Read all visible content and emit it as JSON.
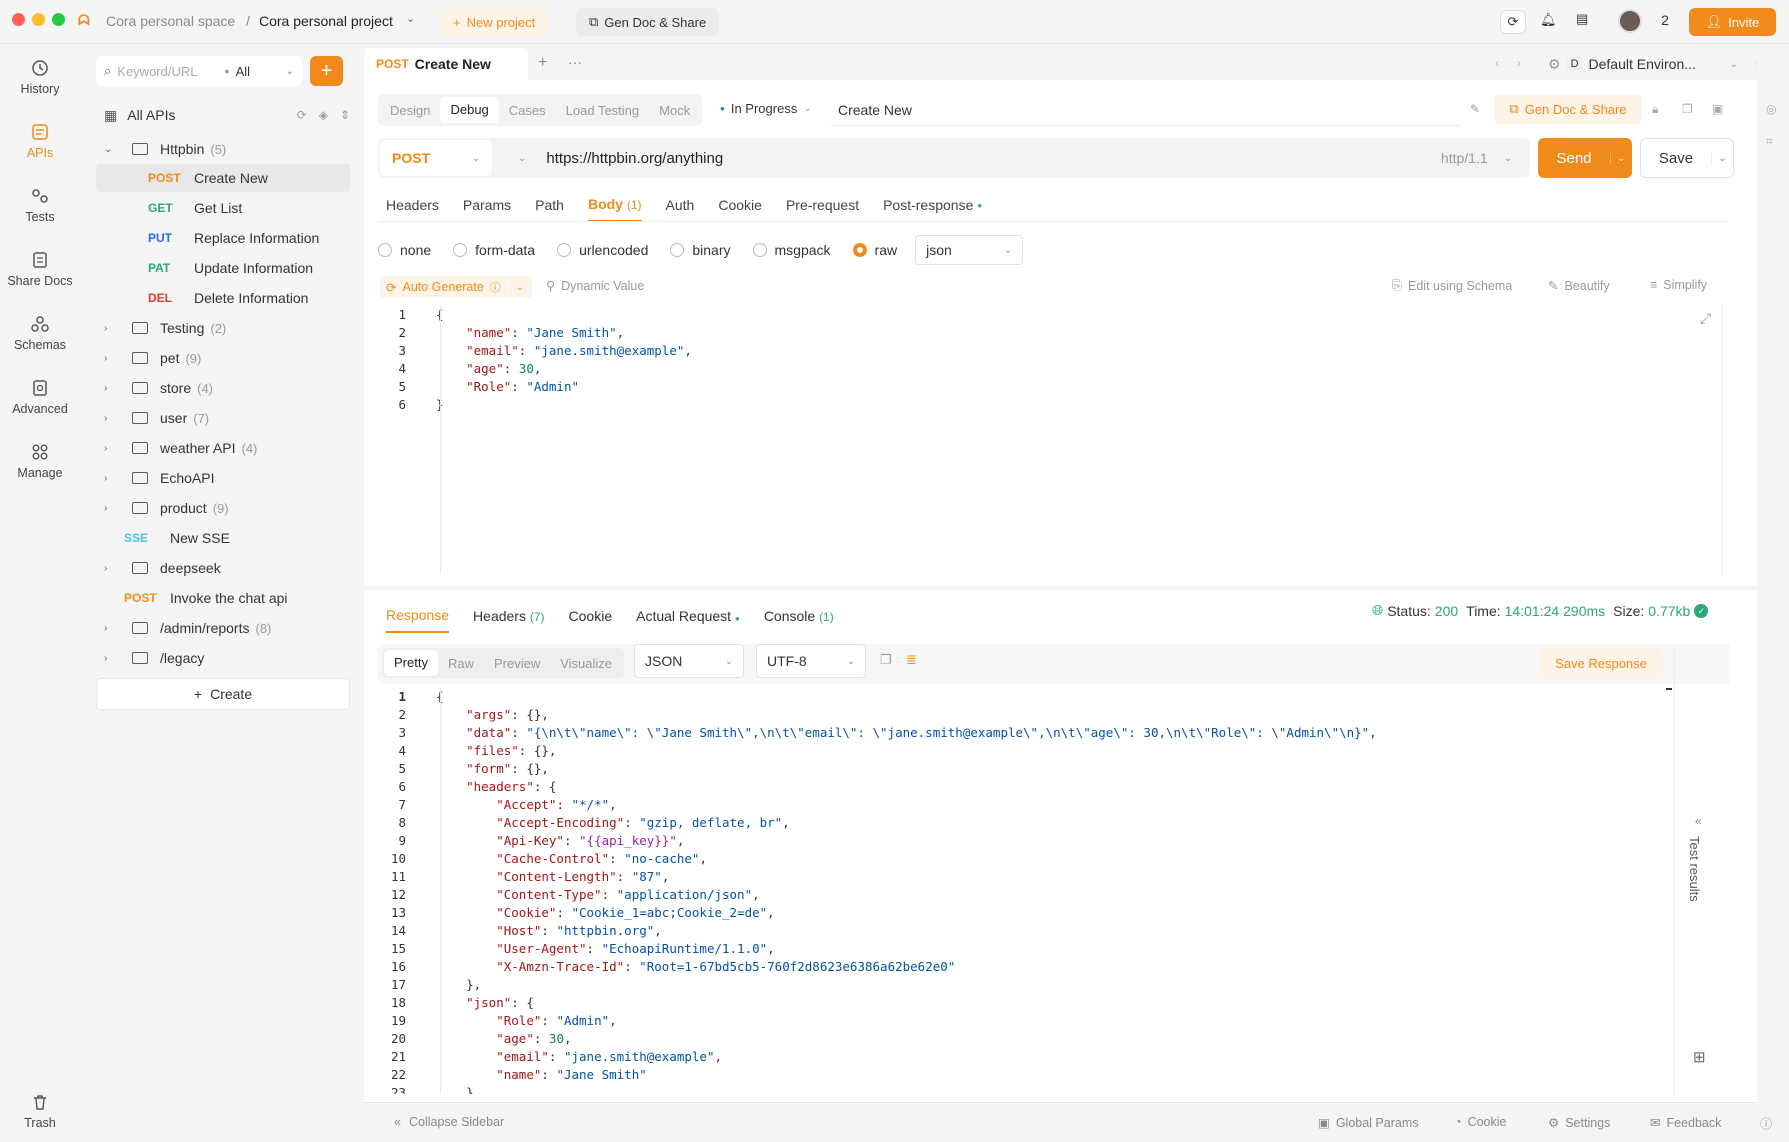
{
  "topbar": {
    "workspace": "Cora personal space",
    "separator": "/",
    "project": "Cora personal project",
    "new_project": "New project",
    "gen_doc": "Gen Doc & Share",
    "member_count": "2",
    "invite": "Invite"
  },
  "leftnav": [
    {
      "label": "History",
      "icon": "clock-icon"
    },
    {
      "label": "APIs",
      "icon": "api-icon"
    },
    {
      "label": "Tests",
      "icon": "tests-icon"
    },
    {
      "label": "Share Docs",
      "icon": "doc-icon"
    },
    {
      "label": "Schemas",
      "icon": "schema-icon"
    },
    {
      "label": "Advanced",
      "icon": "advanced-icon"
    },
    {
      "label": "Manage",
      "icon": "grid-icon"
    },
    {
      "label": "Trash",
      "icon": "trash-icon"
    }
  ],
  "sidebar": {
    "search_placeholder": "Keyword/URL",
    "filter": "All",
    "all_apis": "All APIs",
    "root": {
      "name": "Httpbin",
      "count": "(5)"
    },
    "endpoints": [
      {
        "method": "POST",
        "name": "Create New",
        "color": "#f08a1c"
      },
      {
        "method": "GET",
        "name": "Get List",
        "color": "#2aa876"
      },
      {
        "method": "PUT",
        "name": "Replace Information",
        "color": "#2a6fd6"
      },
      {
        "method": "PAT",
        "name": "Update Information",
        "color": "#2aa876"
      },
      {
        "method": "DEL",
        "name": "Delete Information",
        "color": "#e03b2e"
      }
    ],
    "folders": [
      {
        "name": "Testing",
        "count": "(2)"
      },
      {
        "name": "pet",
        "count": "(9)"
      },
      {
        "name": "store",
        "count": "(4)"
      },
      {
        "name": "user",
        "count": "(7)"
      },
      {
        "name": "weather API",
        "count": "(4)"
      },
      {
        "name": "EchoAPI",
        "count": ""
      },
      {
        "name": "product",
        "count": "(9)"
      }
    ],
    "sse": {
      "method": "SSE",
      "name": "New SSE"
    },
    "deepseek": {
      "name": "deepseek"
    },
    "invoke": {
      "method": "POST",
      "name": "Invoke the chat api"
    },
    "admin": {
      "name": "/admin/reports",
      "count": "(8)"
    },
    "legacy": {
      "name": "/legacy"
    },
    "create": "Create"
  },
  "tab": {
    "method": "POST",
    "title": "Create New"
  },
  "env": "Default Environ...",
  "modes": [
    "Design",
    "Debug",
    "Cases",
    "Load Testing",
    "Mock"
  ],
  "status": "In Progress",
  "name_field": "Create New",
  "gen_doc2": "Gen Doc & Share",
  "request": {
    "method": "POST",
    "url": "https://httpbin.org/anything",
    "protocol": "http/1.1",
    "send": "Send",
    "save": "Save"
  },
  "req_tabs": [
    "Headers",
    "Params",
    "Path",
    "Body",
    "Auth",
    "Cookie",
    "Pre-request",
    "Post-response"
  ],
  "body_count": "(1)",
  "body_types": [
    "none",
    "form-data",
    "urlencoded",
    "binary",
    "msgpack",
    "raw"
  ],
  "body_format": "json",
  "auto_generate": "Auto Generate",
  "dynamic_value": "Dynamic Value",
  "edit_schema": "Edit using Schema",
  "beautify": "Beautify",
  "simplify": "Simplify",
  "response": {
    "tabs": [
      "Response",
      "Headers",
      "Cookie",
      "Actual Request",
      "Console"
    ],
    "headers_count": "(7)",
    "console_count": "(1)",
    "status_label": "Status:",
    "status": "200",
    "time_label": "Time:",
    "time": "14:01:24",
    "duration": "290ms",
    "size_label": "Size:",
    "size": "0.77kb",
    "views": [
      "Pretty",
      "Raw",
      "Preview",
      "Visualize"
    ],
    "format": "JSON",
    "encoding": "UTF-8",
    "save": "Save Response",
    "test_results": "Test results"
  },
  "bottombar": {
    "collapse": "Collapse Sidebar",
    "global": "Global Params",
    "cookie": "Cookie",
    "settings": "Settings",
    "feedback": "Feedback"
  }
}
